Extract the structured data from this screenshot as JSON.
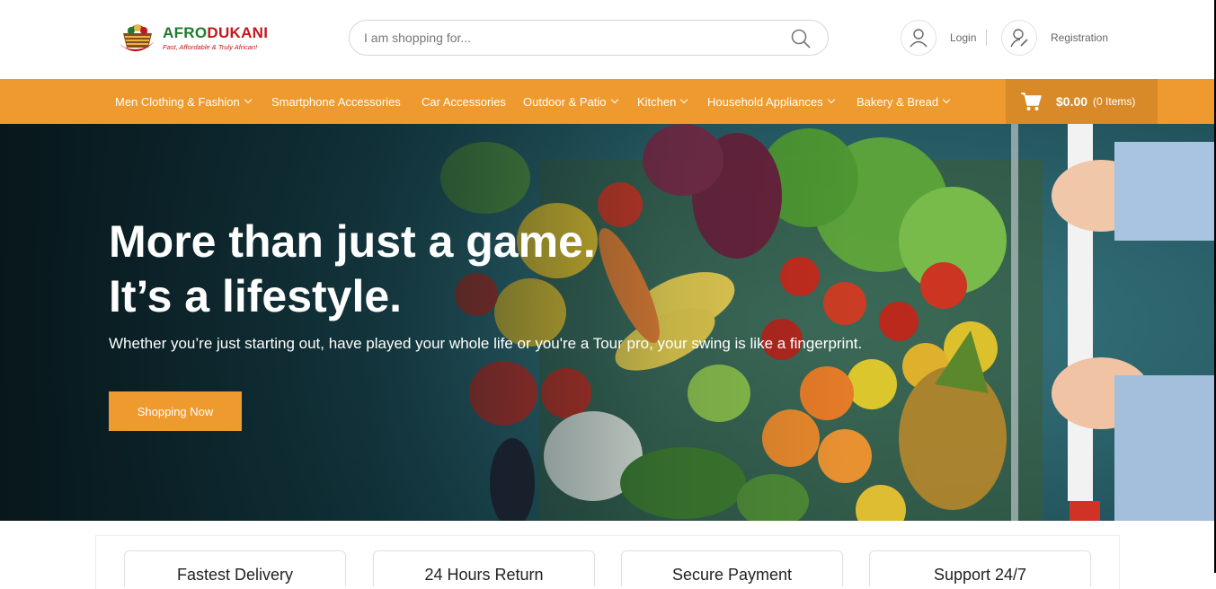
{
  "brand": {
    "name_part1": "AFRO",
    "name_part2": "DUKANI",
    "tagline": "Fast, Affordable & Truly African!"
  },
  "search": {
    "placeholder": "I am shopping for...",
    "icon": "search-icon"
  },
  "account": {
    "login_label": "Login",
    "registration_label": "Registration"
  },
  "nav": {
    "items": [
      {
        "label": "Men Clothing & Fashion",
        "dropdown": true
      },
      {
        "label": "Smartphone Accessories",
        "dropdown": false
      },
      {
        "label": "Car Accessories",
        "dropdown": false
      },
      {
        "label": "Outdoor & Patio",
        "dropdown": true
      },
      {
        "label": "Kitchen",
        "dropdown": true
      },
      {
        "label": "Household Appliances",
        "dropdown": true
      },
      {
        "label": "Bakery & Bread",
        "dropdown": true
      }
    ]
  },
  "cart": {
    "amount": "$0.00",
    "count": "(0 Items)"
  },
  "hero": {
    "title_line1": "More than just a game.",
    "title_line2": "It’s a lifestyle.",
    "subtitle": "Whether you’re just starting out, have played your whole life or you're a Tour pro, your swing is like a fingerprint.",
    "button_label": "Shopping Now"
  },
  "features": [
    {
      "label": "Fastest Delivery"
    },
    {
      "label": "24 Hours Return"
    },
    {
      "label": "Secure Payment"
    },
    {
      "label": "Support 24/7"
    }
  ],
  "colors": {
    "accent": "#ee9a2f",
    "cart_bg": "#d98a28",
    "brand_green": "#1f7a2e",
    "brand_red": "#c4161c"
  }
}
